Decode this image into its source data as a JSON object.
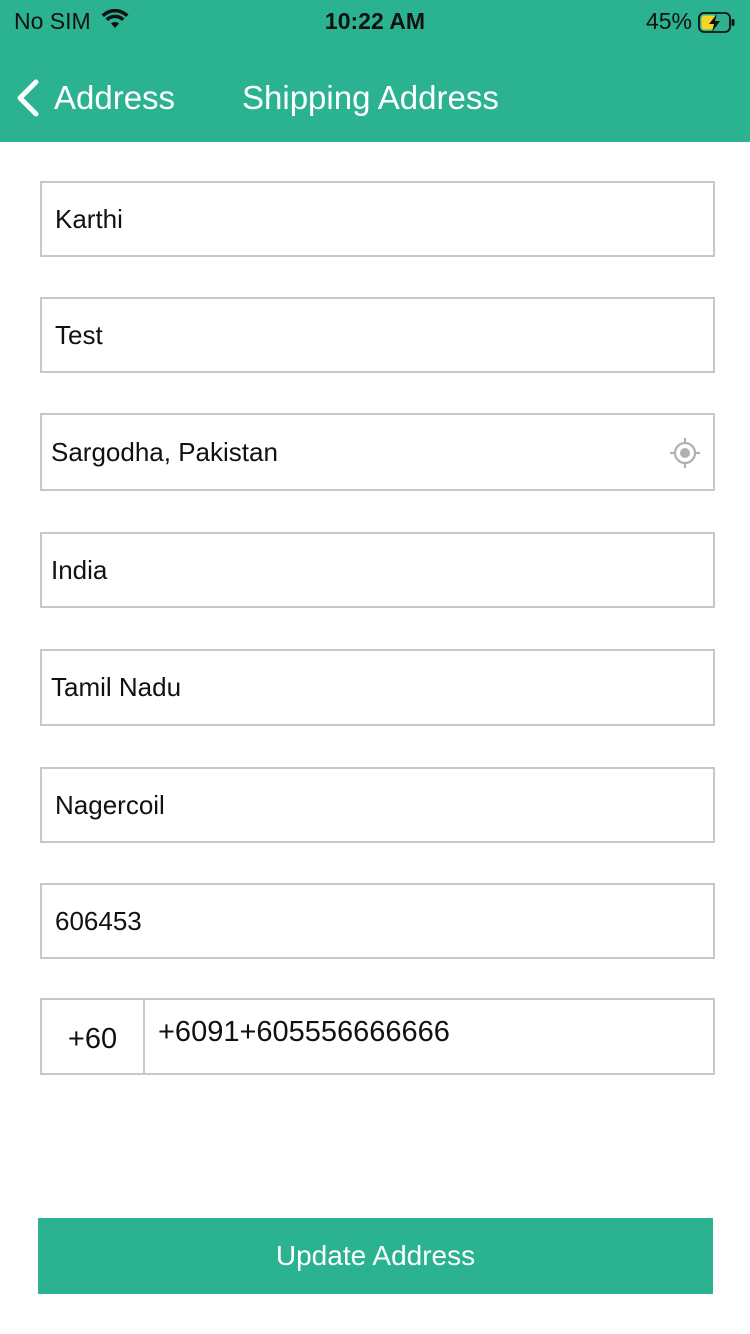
{
  "status_bar": {
    "carrier": "No SIM",
    "time": "10:22 AM",
    "battery_percent": "45%",
    "icons": [
      "wifi-icon",
      "battery-charging-icon"
    ]
  },
  "nav": {
    "back_label": "Address",
    "title": "Shipping Address",
    "icons": [
      "chevron-left-icon"
    ]
  },
  "form": {
    "first_name": "Karthi",
    "last_name": "Test",
    "location": "Sargodha, Pakistan",
    "location_icon": "gps-locate-icon",
    "country": "India",
    "state": "Tamil Nadu",
    "city": "Nagercoil",
    "postal_code": "606453",
    "phone_code": "+60",
    "phone_number": "+6091+605556666666"
  },
  "actions": {
    "update_label": "Update Address"
  },
  "colors": {
    "accent": "#2ab291",
    "border": "#c8c8c8",
    "battery_fill": "#f5d623"
  }
}
